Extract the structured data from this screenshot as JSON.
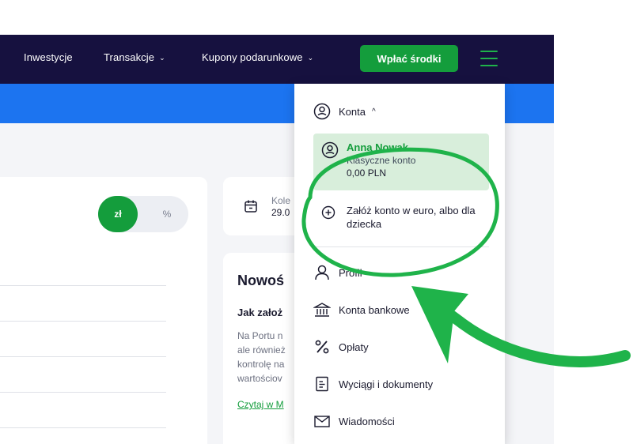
{
  "nav": {
    "items": [
      {
        "label": "Inwestycje",
        "has_dropdown": false
      },
      {
        "label": "Transakcje",
        "has_dropdown": true
      },
      {
        "label": "Kupony podarunkowe",
        "has_dropdown": true
      }
    ],
    "chevron": "⌄",
    "deposit_label": "Wpłać środki",
    "menu_icon": "hamburger-icon"
  },
  "portfolio": {
    "toggle_zl": "zł",
    "toggle_pct": "%"
  },
  "calendar_card": {
    "label": "Kole",
    "date": "29.0"
  },
  "news": {
    "title": "Nowoś",
    "subtitle": "Jak założ",
    "lines": [
      "Na Portu n",
      "ale również",
      "kontrolę na",
      "wartościov"
    ],
    "link": "Czytaj w M"
  },
  "menu": {
    "konta_label": "Konta",
    "konta_chevron": "^",
    "account": {
      "name": "Anna Nowak",
      "type": "Klasyczne konto",
      "balance": "0,00 PLN"
    },
    "add_account": "Załóż konto w euro, albo dla dziecka",
    "items": [
      {
        "label": "Profil",
        "icon": "user-icon"
      },
      {
        "label": "Konta bankowe",
        "icon": "bank-icon"
      },
      {
        "label": "Opłaty",
        "icon": "percent-icon"
      },
      {
        "label": "Wyciągi i dokumenty",
        "icon": "document-icon"
      },
      {
        "label": "Wiadomości",
        "icon": "envelope-icon"
      }
    ]
  },
  "colors": {
    "nav_bg": "#16113f",
    "accent_green": "#149d3c",
    "blue_stripe": "#1c74f0",
    "annotation_green": "#1fb34a"
  }
}
